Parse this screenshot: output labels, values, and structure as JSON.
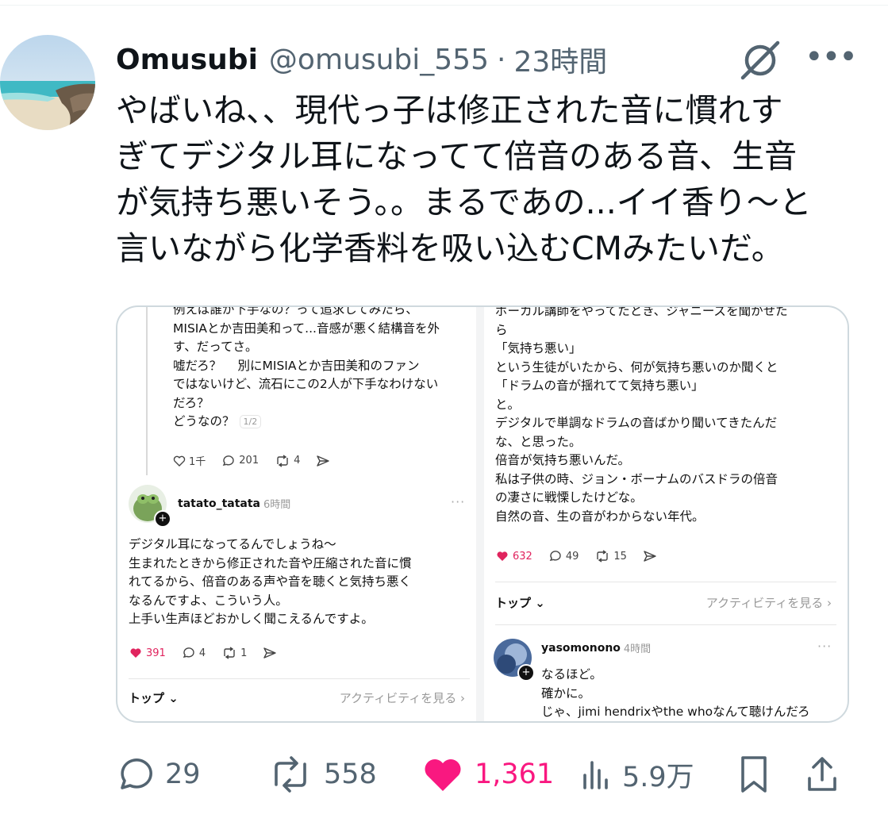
{
  "tweet": {
    "author_name": "Omusubi",
    "handle": "@omusubi_555",
    "separator": "·",
    "time": "23時間",
    "more_label": "•••",
    "text_lines": [
      "やばいね、、現代っ子は修正された音に慣れす",
      "ぎてデジタル耳になってて倍音のある音、生音",
      "が気持ち悪いそう。。まるであの...イイ香り〜と",
      "言いながら化学香料を吸い込むCMみたいだ。"
    ]
  },
  "embedded": {
    "left": {
      "post_lines": [
        "例えば誰が下手なの？って追求してみたら、",
        "MISIAとか吉田美和って...音感が悪く結構音を外",
        "す、だってさ。",
        "嘘だろ？　 別にMISIAとか吉田美和のファン",
        "ではないけど、流石にこの2人が下手なわけない",
        "だろ？",
        "どうなの？"
      ],
      "pager": "1/2",
      "actions": {
        "likes": "1千",
        "replies": "201",
        "reposts": "4"
      },
      "reply": {
        "username": "tatato_tatata",
        "time": "6時間",
        "lines": [
          "デジタル耳になってるんでしょうね〜",
          "生まれたときから修正された音や圧縮された音に慣",
          "れてるから、倍音のある声や音を聴くと気持ち悪く",
          "なるんですよ、こういう人。",
          "上手い生声ほどおかしく聞こえるんですよ。"
        ],
        "likes": "391",
        "replies": "4",
        "reposts": "1"
      },
      "top_label": "トップ",
      "activity_label": "アクティビティを見る"
    },
    "right": {
      "post_lines": [
        "ボーカル講師をやってたとき、ジャニーズを聞かせた",
        "ら",
        "「気持ち悪い」",
        "という生徒がいたから、何が気持ち悪いのか聞くと",
        "「ドラムの音が揺れてて気持ち悪い」",
        "と。",
        "デジタルで単調なドラムの音ばかり聞いてきたんだ",
        "な、と思った。",
        "倍音が気持ち悪いんだ。",
        "私は子供の時、ジョン・ボーナムのバスドラの倍音",
        "の凄さに戦慄したけどな。",
        "自然の音、生の音がわからない年代。"
      ],
      "actions": {
        "likes": "632",
        "replies": "49",
        "reposts": "15"
      },
      "top_label": "トップ",
      "activity_label": "アクティビティを見る",
      "reply": {
        "username": "yasomonono",
        "time": "4時間",
        "lines": [
          "なるほど。",
          "確かに。",
          "じゃ、jimi hendrixやthe whoなんて聴けんだろ"
        ]
      }
    }
  },
  "stats": {
    "replies": "29",
    "reposts": "558",
    "likes": "1,361",
    "views": "5.9万"
  },
  "colors": {
    "like_pink": "#f91880",
    "muted": "#536471",
    "text": "#0f1419"
  }
}
